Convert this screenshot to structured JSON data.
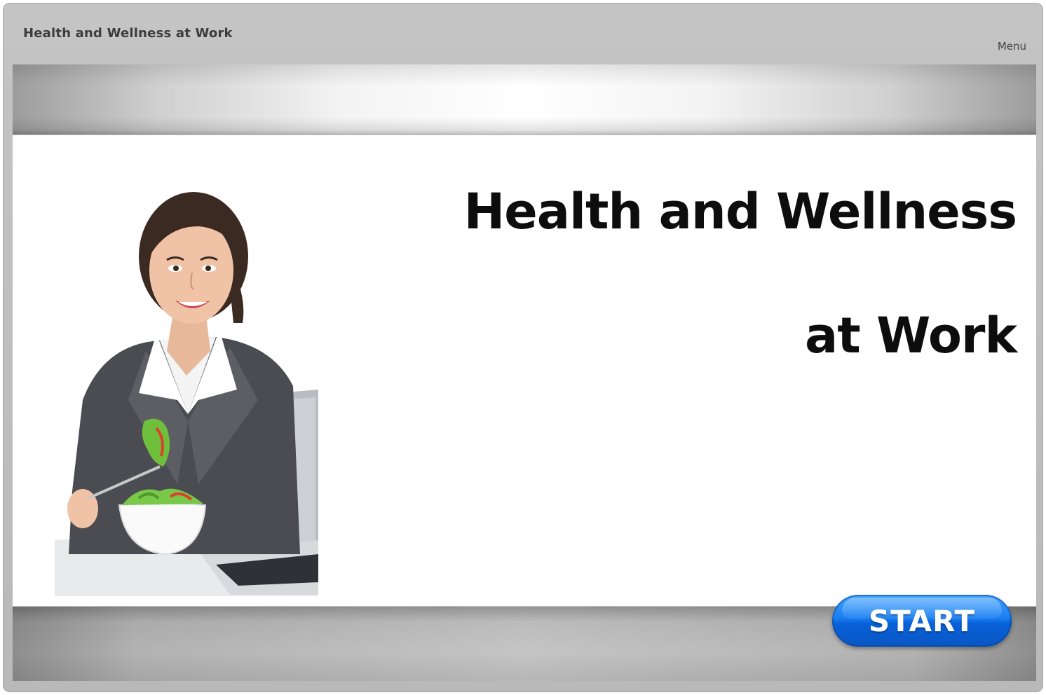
{
  "header": {
    "course_title": "Health and Wellness at Work",
    "menu_label": "Menu"
  },
  "slide": {
    "headline_line1": "Health and Wellness",
    "headline_line2": "at Work",
    "photo_icon": "woman-eating-salad-photo"
  },
  "footer": {
    "start_label": "START"
  },
  "colors": {
    "start_button": "#1a7ef2",
    "frame": "#bdbdbd",
    "headline": "#0d0d0d"
  }
}
